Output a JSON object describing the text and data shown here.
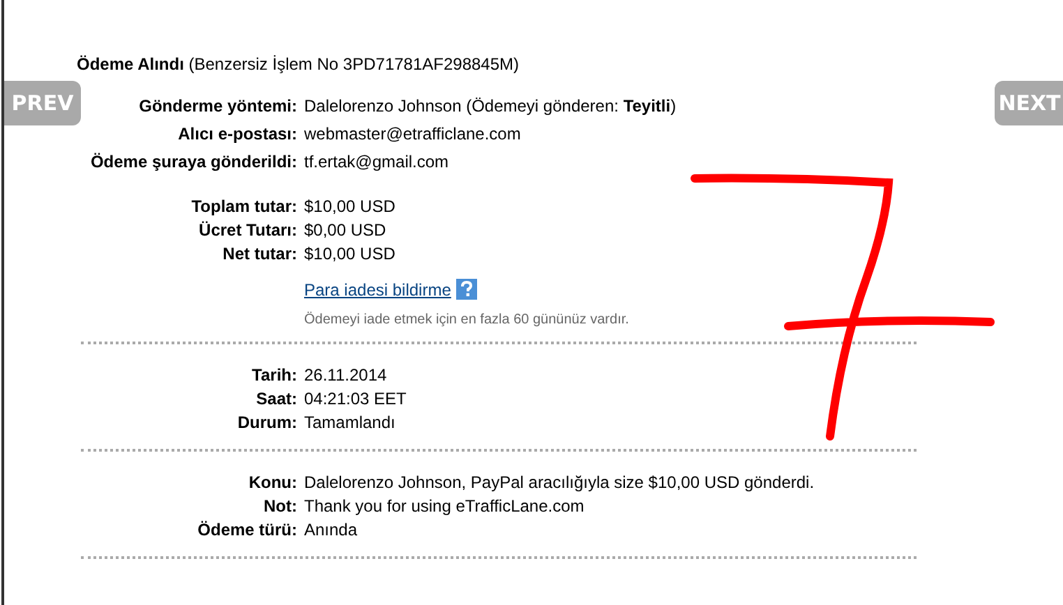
{
  "title": "**Ödeme Alındı** (Benzersiz İşlem No 3PD71781AF298845M)",
  "nav": [
    {
      "label": "PREV"
    },
    {
      "label": "NEXT"
    }
  ],
  "sections": [
    {
      "divider": false,
      "rows": [
        {
          "label": "Gönderme yöntemi:",
          "value": "Dalelorenzo Johnson (Ödemeyi gönderen: **Teyitli**)"
        },
        {
          "label": "Alıcı e-postası:",
          "value": "webmaster@etrafficlane.com"
        },
        {
          "label": "Ödeme şuraya gönderildi:",
          "value": "tf.ertak@gmail.com"
        }
      ]
    },
    {
      "divider": true,
      "rows": [
        {
          "label": "Toplam tutar:",
          "value": "$10,00 USD"
        },
        {
          "label": "Ücret Tutarı:",
          "value": "$0,00 USD"
        },
        {
          "label": "Net tutar:",
          "value": "$10,00 USD"
        }
      ],
      "link": "Para iadesi bildirme",
      "note": "Ödemeyi iade etmek için en fazla 60 gününüz vardır."
    },
    {
      "divider": true,
      "rows": [
        {
          "label": "Tarih:",
          "value": "26.11.2014"
        },
        {
          "label": "Saat:",
          "value": "04:21:03 EET"
        },
        {
          "label": "Durum:",
          "value": "Tamamlandı"
        }
      ]
    },
    {
      "divider": true,
      "rows": [
        {
          "label": "Konu:",
          "value": "Dalelorenzo Johnson, PayPal aracılığıyla size $10,00 USD gönderdi."
        },
        {
          "label": "Not:",
          "value": "Thank you for using eTrafficLane.com"
        },
        {
          "label": "Ödeme türü:",
          "value": "Anında"
        }
      ]
    }
  ]
}
